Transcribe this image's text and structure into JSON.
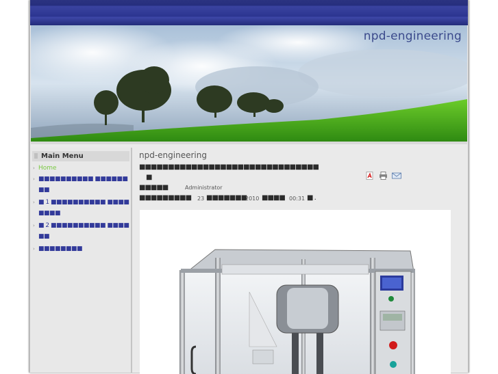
{
  "site": {
    "name": "npd-engineering"
  },
  "sidebar": {
    "title": "Main Menu",
    "items": [
      {
        "label": "Home",
        "active": true
      },
      {
        "label": "■■■■■■■■■■ ■■■■■■■■"
      },
      {
        "label": "■ 1 ■■■■■■■■■■ ■■■■■■■■"
      },
      {
        "label": "■ 2 ■■■■■■■■■■ ■■■■■■"
      },
      {
        "label": "■■■■■■■■"
      }
    ]
  },
  "article": {
    "title": "npd-engineering",
    "subtitle_garbled": "■■■■■■■■■■■■■■■■■■■■■■■■■■■■■■■",
    "subtitle_garbled_2": "■",
    "author_prefix": "■■■■■",
    "author": "Administrator",
    "date_prefix": "■■■■■■■■■",
    "day": "23",
    "month_garbled": "■■■■■■■",
    "year": "2010",
    "time_prefix": "■■■■",
    "time": "00:31",
    "time_suffix": "■ ."
  },
  "icons": {
    "pdf": "pdf-icon",
    "print": "print-icon",
    "email": "email-icon"
  },
  "colors": {
    "topbar": "#2c3590",
    "link": "#3a3f9c",
    "active_link": "#7ac943"
  }
}
